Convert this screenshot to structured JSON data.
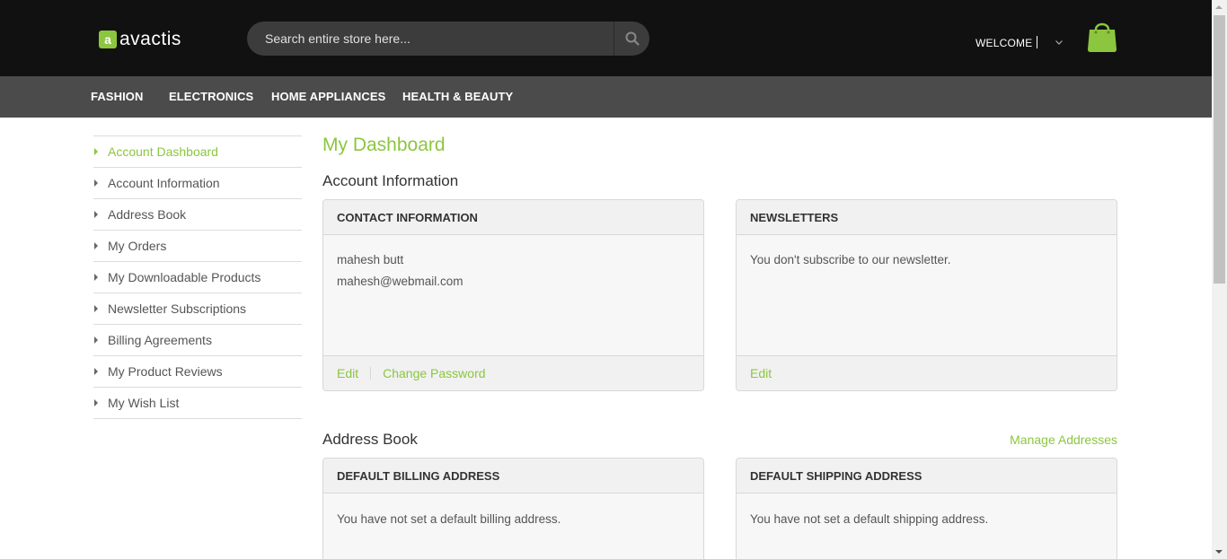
{
  "header": {
    "logo_mark": "a",
    "logo_text": "avactis",
    "search_placeholder": "Search entire store here...",
    "welcome": "WELCOME"
  },
  "nav": {
    "items": [
      {
        "label": "FASHION"
      },
      {
        "label": "ELECTRONICS"
      },
      {
        "label": "HOME APPLIANCES"
      },
      {
        "label": "HEALTH & BEAUTY"
      }
    ]
  },
  "sidebar": {
    "items": [
      {
        "label": "Account Dashboard",
        "active": true
      },
      {
        "label": "Account Information"
      },
      {
        "label": "Address Book"
      },
      {
        "label": "My Orders"
      },
      {
        "label": "My Downloadable Products"
      },
      {
        "label": "Newsletter Subscriptions"
      },
      {
        "label": "Billing Agreements"
      },
      {
        "label": "My Product Reviews"
      },
      {
        "label": "My Wish List"
      }
    ]
  },
  "main": {
    "title": "My Dashboard",
    "account_info": {
      "heading": "Account Information",
      "contact": {
        "title": "CONTACT INFORMATION",
        "name": "mahesh butt",
        "email": "mahesh@webmail.com",
        "edit": "Edit",
        "change_password": "Change Password"
      },
      "newsletters": {
        "title": "NEWSLETTERS",
        "text": "You don't subscribe to our newsletter.",
        "edit": "Edit"
      }
    },
    "address_book": {
      "heading": "Address Book",
      "manage": "Manage Addresses",
      "billing": {
        "title": "DEFAULT BILLING ADDRESS",
        "text": "You have not set a default billing address."
      },
      "shipping": {
        "title": "DEFAULT SHIPPING ADDRESS",
        "text": "You have not set a default shipping address."
      }
    }
  },
  "colors": {
    "accent": "#8cc63f",
    "header_bg": "#111111",
    "nav_bg": "#4a4b4a"
  }
}
